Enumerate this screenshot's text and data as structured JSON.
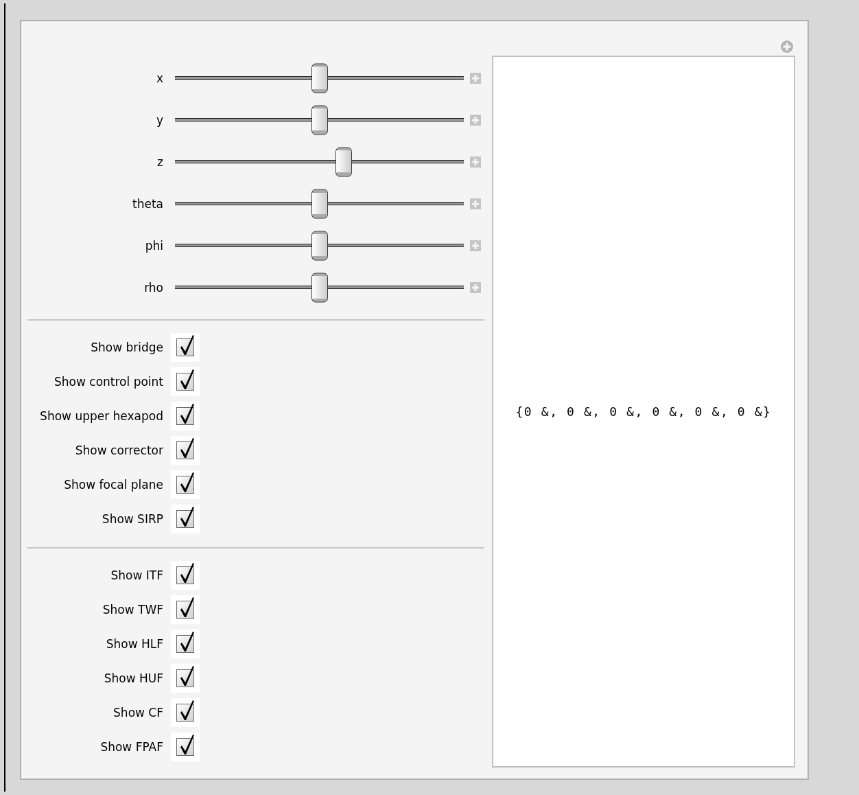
{
  "sliders": [
    {
      "label": "x",
      "level": 0.5
    },
    {
      "label": "y",
      "level": 0.5
    },
    {
      "label": "z",
      "level": 0.585
    },
    {
      "label": "theta",
      "level": 0.5
    },
    {
      "label": "phi",
      "level": 0.5
    },
    {
      "label": "rho",
      "level": 0.5
    }
  ],
  "checkbox_groups": [
    [
      {
        "label": "Show bridge",
        "checked": true
      },
      {
        "label": "Show control point",
        "checked": true
      },
      {
        "label": "Show upper hexapod",
        "checked": true
      },
      {
        "label": "Show corrector",
        "checked": true
      },
      {
        "label": "Show focal plane",
        "checked": true
      },
      {
        "label": "Show SIRP",
        "checked": true
      }
    ],
    [
      {
        "label": "Show ITF",
        "checked": true
      },
      {
        "label": "Show TWF",
        "checked": true
      },
      {
        "label": "Show HLF",
        "checked": true
      },
      {
        "label": "Show HUF",
        "checked": true
      },
      {
        "label": "Show CF",
        "checked": true
      },
      {
        "label": "Show FPAF",
        "checked": true
      }
    ]
  ],
  "output": {
    "text": "{0 &, 0 &, 0 &, 0 &, 0 &, 0 &}"
  }
}
